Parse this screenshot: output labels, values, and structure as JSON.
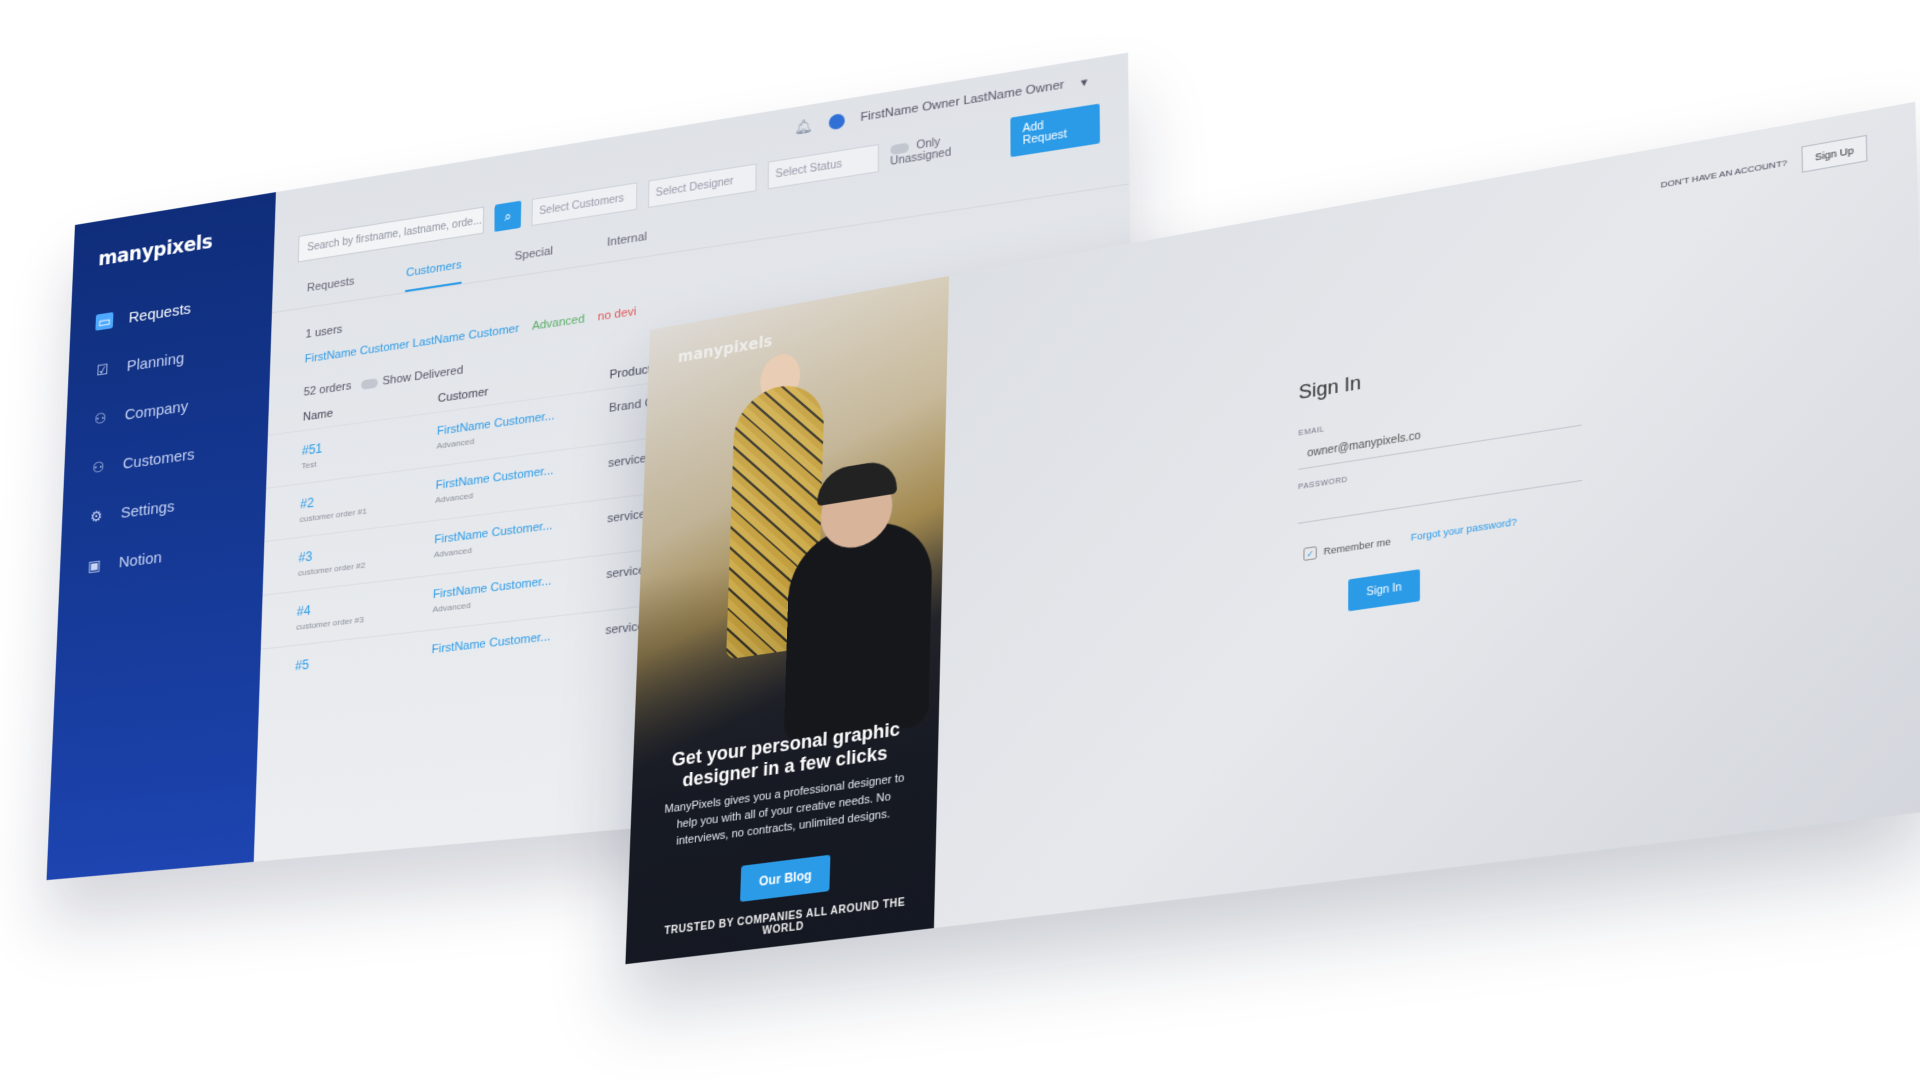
{
  "dashboard": {
    "logo": "manypixels",
    "sidebar": {
      "items": [
        {
          "label": "Requests",
          "icon": "inbox-icon",
          "active": true
        },
        {
          "label": "Planning",
          "icon": "clipboard-icon"
        },
        {
          "label": "Company",
          "icon": "users-icon"
        },
        {
          "label": "Customers",
          "icon": "user-group-icon"
        },
        {
          "label": "Settings",
          "icon": "gear-icon"
        },
        {
          "label": "Notion",
          "icon": "notion-icon"
        }
      ]
    },
    "topbar": {
      "user_name": "FirstName Owner LastName Owner",
      "caret": "▾"
    },
    "filters": {
      "search_placeholder": "Search by firstname, lastname, orde...",
      "select_customers": "Select Customers",
      "select_designer": "Select Designer",
      "select_status": "Select Status",
      "only_unassigned": "Only Unassigned",
      "add_request": "Add Request"
    },
    "tabs": [
      "Requests",
      "Customers",
      "Special",
      "Internal"
    ],
    "users_count": "1 users",
    "customer": {
      "name": "FirstName Customer LastName Customer",
      "tier": "Advanced",
      "status": "no devi"
    },
    "orders": {
      "count": "52 orders",
      "show_delivered": "Show Delivered"
    },
    "table": {
      "headers": [
        "Name",
        "Customer",
        "Product"
      ],
      "rows": [
        {
          "num": "#51",
          "sub": "Test",
          "customer": "FirstName Customer...",
          "tier": "Advanced",
          "product": "Brand Guide"
        },
        {
          "num": "#2",
          "sub": "customer order #1",
          "customer": "FirstName Customer...",
          "tier": "Advanced",
          "product": "service"
        },
        {
          "num": "#3",
          "sub": "customer order #2",
          "customer": "FirstName Customer...",
          "tier": "Advanced",
          "product": "service"
        },
        {
          "num": "#4",
          "sub": "customer order #3",
          "customer": "FirstName Customer...",
          "tier": "Advanced",
          "product": "service"
        },
        {
          "num": "#5",
          "sub": "",
          "customer": "FirstName Customer...",
          "tier": "",
          "product": "service"
        }
      ]
    }
  },
  "signin_page": {
    "hero": {
      "logo": "manypixels",
      "title": "Get your personal graphic designer in a few clicks",
      "text": "ManyPixels gives you a professional designer to help you with all of your creative needs. No interviews, no contracts, unlimited designs.",
      "button": "Our Blog",
      "trusted": "TRUSTED BY COMPANIES ALL AROUND THE WORLD"
    },
    "top": {
      "prompt": "DON'T HAVE AN ACCOUNT?",
      "signup": "Sign Up"
    },
    "form": {
      "title": "Sign In",
      "email_label": "EMAIL",
      "email_value": "owner@manypixels.co",
      "password_label": "PASSWORD",
      "remember": "Remember me",
      "forgot": "Forgot your password?",
      "submit": "Sign In"
    }
  },
  "colors": {
    "brand_blue": "#163a98",
    "accent": "#2b9be8"
  }
}
